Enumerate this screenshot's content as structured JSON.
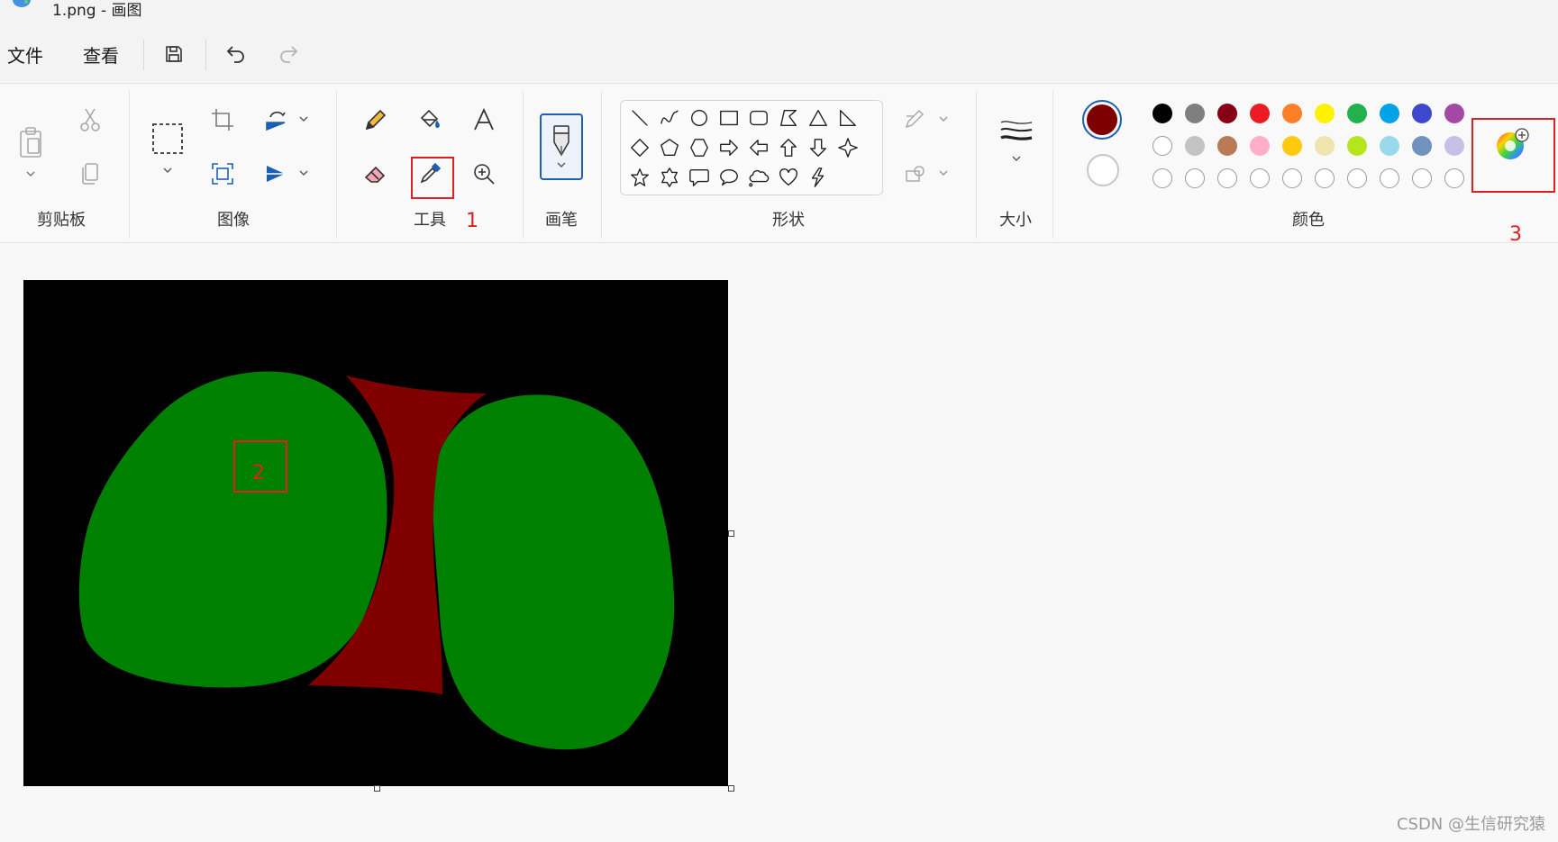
{
  "window": {
    "title": "1.png - 画图",
    "app_icon": "paint-palette-icon"
  },
  "menu": {
    "file": "文件",
    "view": "查看"
  },
  "quick_access": {
    "save_icon": "save-icon",
    "undo_icon": "undo-icon",
    "redo_icon": "redo-icon"
  },
  "ribbon": {
    "groups": {
      "clipboard": "剪贴板",
      "image": "图像",
      "tools": "工具",
      "brushes": "画笔",
      "shapes": "形状",
      "size": "大小",
      "colors": "颜色"
    },
    "clipboard_icons": [
      "paste-icon",
      "cut-icon",
      "copy-icon"
    ],
    "image_icons": [
      "select-icon",
      "crop-icon",
      "resize-icon",
      "rotate-icon",
      "flip-icon"
    ],
    "tool_icons": [
      "pencil-icon",
      "fill-icon",
      "text-icon",
      "eraser-icon",
      "color-picker-icon",
      "magnifier-icon"
    ],
    "shape_icons": [
      "line",
      "curve",
      "oval",
      "rectangle",
      "rounded-rectangle",
      "polygon",
      "triangle",
      "right-triangle",
      "diamond",
      "pentagon",
      "hexagon",
      "right-arrow",
      "left-arrow",
      "up-arrow",
      "down-arrow",
      "four-point-star",
      "five-point-star",
      "six-point-star",
      "rounded-callout",
      "oval-callout",
      "cloud-callout",
      "heart",
      "lightning"
    ],
    "primary_color": "#7f0000",
    "secondary_color": "#ffffff",
    "palette_row1": [
      "#000000",
      "#7f7f7f",
      "#880015",
      "#ed1c24",
      "#ff7f27",
      "#fff200",
      "#22b14c",
      "#00a2e8",
      "#3f48cc",
      "#a349a4"
    ],
    "palette_row2": [
      "#ffffff",
      "#c3c3c3",
      "#b97a57",
      "#ffaec9",
      "#ffc90e",
      "#efe4b0",
      "#b5e61d",
      "#99d9ea",
      "#7092be",
      "#c8bfe7"
    ],
    "palette_row3_empty": 10,
    "edit_colors_icon": "color-wheel-icon"
  },
  "annotations": {
    "tool_marker": "1",
    "canvas_marker": "2",
    "color_marker": "3",
    "color": "#e02020"
  },
  "canvas": {
    "background": "#000000",
    "blob_color": "#008000",
    "wedge_color": "#800000"
  },
  "watermark": "CSDN @生信研究猿"
}
